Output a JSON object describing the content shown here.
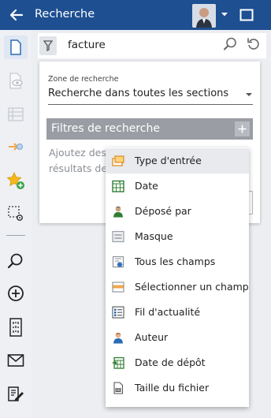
{
  "header": {
    "title": "Recherche"
  },
  "search": {
    "value": "facture"
  },
  "panel": {
    "zone_label": "Zone de recherche",
    "zone_value": "Recherche dans toutes les sections",
    "filters_title": "Filtres de recherche",
    "hint_line1": "Ajoutez des",
    "hint_line2": "résultats de r"
  },
  "dropdown": {
    "items": [
      {
        "label": "Type d'entrée",
        "icon": "entry-type-icon"
      },
      {
        "label": "Date",
        "icon": "calendar-icon"
      },
      {
        "label": "Déposé par",
        "icon": "user-icon"
      },
      {
        "label": "Masque",
        "icon": "mask-icon"
      },
      {
        "label": "Tous les champs",
        "icon": "all-fields-icon"
      },
      {
        "label": "Sélectionner un champ",
        "icon": "select-field-icon"
      },
      {
        "label": "Fil d'actualité",
        "icon": "feed-icon"
      },
      {
        "label": "Auteur",
        "icon": "author-icon"
      },
      {
        "label": "Date de dépôt",
        "icon": "deposit-date-icon"
      },
      {
        "label": "Taille du fichier",
        "icon": "file-size-icon"
      }
    ]
  },
  "colors": {
    "header": "#1d4f91",
    "filters_bar": "#9a9da3",
    "sidebar": "#eef0f3"
  }
}
